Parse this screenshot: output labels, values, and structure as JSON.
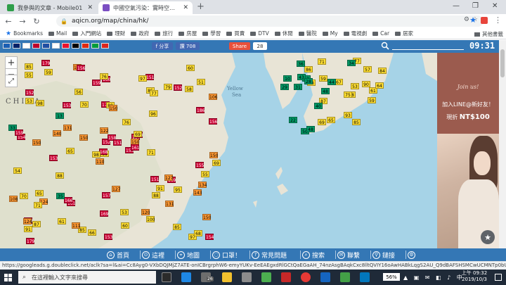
{
  "browser": {
    "tabs": [
      {
        "title": "我參與的文章 - Mobile01",
        "active": false,
        "favicon_color": "#2e9e4a"
      },
      {
        "title": "中國空氣污染：實時空氣質量指數地圖",
        "active": true,
        "favicon_color": "#7a4ec2"
      }
    ],
    "new_tab": "+",
    "url": "aqicn.org/map/china/hk/",
    "bookmarks_label": "Bookmarks",
    "bookmark_folders": [
      "Mail",
      "入門網站",
      "理財",
      "政府",
      "旅行",
      "房屋",
      "學習",
      "買賣",
      "DTV",
      "休閒",
      "醫院",
      "My",
      "電視劇",
      "Car",
      "居家"
    ],
    "other_bookmarks": "其他書籤"
  },
  "site": {
    "fb_share": "f 分享",
    "fb_like": "讚 708",
    "share": "Share",
    "share_count": "28",
    "clock": "09:31",
    "flags": [
      "#1a5fb4",
      "#012169",
      "#fff",
      "#bc002d",
      "#1f4ea3",
      "#fff",
      "#e8112d",
      "#000",
      "#de2910",
      "#009c3b",
      "#da251d"
    ]
  },
  "map": {
    "labels": {
      "china": "CHINA",
      "yellow_sea_1": "Yellow",
      "yellow_sea_2": "Sea"
    },
    "zoom_in": "+",
    "zoom_out": "−",
    "fullscreen": "⤢",
    "station_values": [
      "68",
      "10",
      "88",
      "158",
      "157",
      "161",
      "151",
      "42",
      "57",
      "153",
      "59",
      "154",
      "150",
      "106",
      "110",
      "96",
      "69",
      "171",
      "76",
      "124",
      "67",
      "91",
      "61",
      "80",
      "158",
      "169",
      "98",
      "160",
      "154",
      "151",
      "156",
      "168",
      "169",
      "152",
      "153",
      "79",
      "166",
      "97",
      "150",
      "127",
      "77",
      "31",
      "140",
      "88",
      "65",
      "33",
      "150",
      "179",
      "93",
      "161",
      "71",
      "186",
      "86",
      "91",
      "100",
      "22",
      "71",
      "85",
      "53",
      "58",
      "34",
      "65",
      "29",
      "13",
      "152",
      "179",
      "97",
      "159",
      "158",
      "108",
      "157",
      "85",
      "59",
      "131",
      "124",
      "55",
      "59",
      "54",
      "122",
      "60",
      "53",
      "87",
      "71",
      "134",
      "153",
      "48",
      "127",
      "85",
      "85",
      "120",
      "76",
      "69",
      "90",
      "131",
      "151",
      "143",
      "58",
      "50",
      "85",
      "77",
      "153",
      "133",
      "150",
      "159",
      "87",
      "35",
      "111",
      "69",
      "84",
      "150",
      "155",
      "152",
      "150",
      "98",
      "156",
      "70",
      "75",
      "51",
      "43",
      "36",
      "40",
      "60",
      "28",
      "70",
      "61",
      "88",
      "68",
      "66",
      "64",
      "53",
      "65",
      "48",
      "44",
      "56",
      "55",
      "95"
    ]
  },
  "ad": {
    "script": "Join us!",
    "line1": "加入LINE@新好友！",
    "line2_prefix": "現折",
    "line2_value": "NT$100",
    "close": "★"
  },
  "bottom_nav": [
    {
      "label": "首頁",
      "icon": "⌂"
    },
    {
      "label": "這裡",
      "icon": "⊙"
    },
    {
      "label": "地圖",
      "icon": "⌖"
    },
    {
      "label": "口罩！",
      "icon": "◌"
    },
    {
      "label": "常見問題",
      "icon": "?"
    },
    {
      "label": "搜索",
      "icon": "⌕"
    },
    {
      "label": "聯繫",
      "icon": "✉"
    },
    {
      "label": "鏈接",
      "icon": "⚲"
    },
    {
      "label": "",
      "icon": "⚙"
    }
  ],
  "status_url": "https://googleads.g.doubleclick.net/aclk?sa=l&ai=Cc8Ayg0-VXbDQJMjZ7ATE-onICBrgrphW6-emyYUKv-EeEAEgxdRlGCtQaEGaAH_74nzAsgBAqkCxc8lltQVIY16oAwHABkLqgS2AU_Q9dBAFSHSMCwUCMNTp0bUZG...",
  "taskbar": {
    "search_placeholder": "在這裡輸入文字來搜尋",
    "badge_count": "26",
    "battery": "56%",
    "time_line1": "上午 09:32",
    "time_line2": "2019/10/3"
  }
}
